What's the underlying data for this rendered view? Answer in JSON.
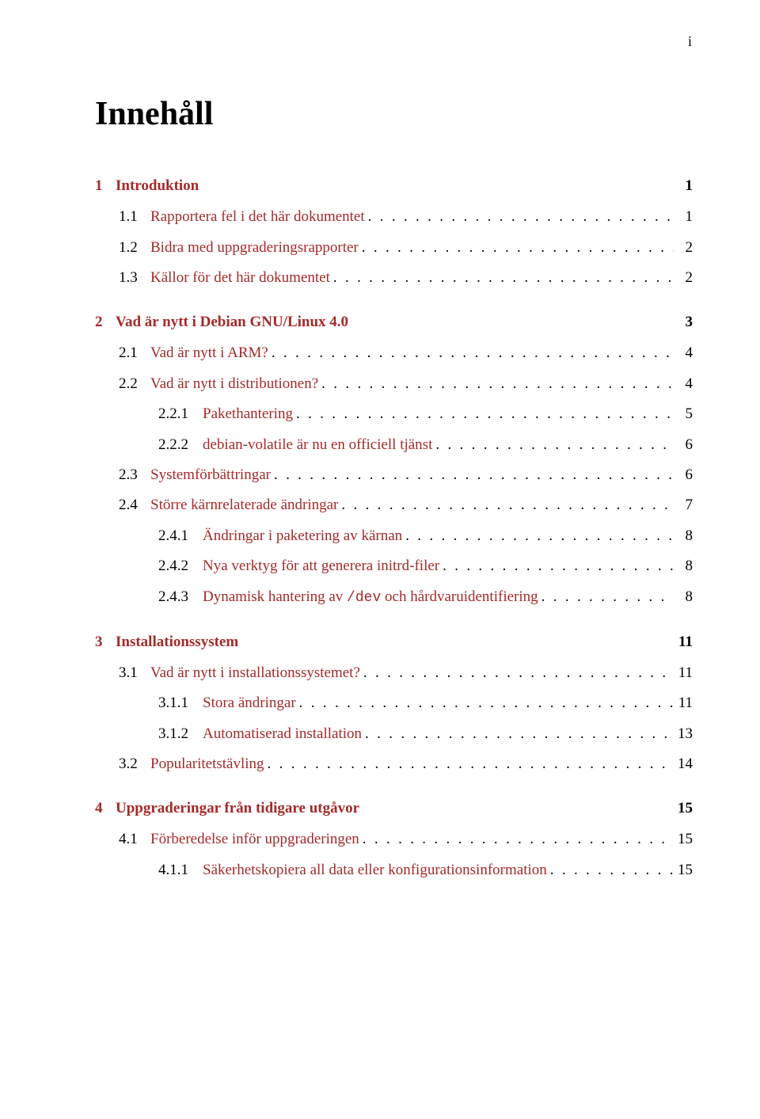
{
  "page_number_top": "i",
  "title": "Innehåll",
  "leader": ". . . . . . . . . . . . . . . . . . . . . . . . . . . . . . . . . . . . . . . . . . . . . . . . . . . . . . . . . . . .",
  "entries": [
    {
      "level": "chapter",
      "num": "1",
      "label": "Introduktion",
      "page": "1",
      "leader": false
    },
    {
      "level": "section",
      "num": "1.1",
      "label": "Rapportera fel i det här dokumentet",
      "page": "1",
      "leader": true
    },
    {
      "level": "section",
      "num": "1.2",
      "label": "Bidra med uppgraderingsrapporter",
      "page": "2",
      "leader": true
    },
    {
      "level": "section",
      "num": "1.3",
      "label": "Källor för det här dokumentet",
      "page": "2",
      "leader": true
    },
    {
      "level": "chapter",
      "num": "2",
      "label": "Vad är nytt i Debian GNU/Linux 4.0",
      "page": "3",
      "leader": false
    },
    {
      "level": "section",
      "num": "2.1",
      "label": "Vad är nytt i ARM?",
      "page": "4",
      "leader": true
    },
    {
      "level": "section",
      "num": "2.2",
      "label": "Vad är nytt i distributionen?",
      "page": "4",
      "leader": true
    },
    {
      "level": "subsection",
      "num": "2.2.1",
      "label": "Pakethantering",
      "page": "5",
      "leader": true
    },
    {
      "level": "subsection",
      "num": "2.2.2",
      "label": "debian-volatile är nu en officiell tjänst",
      "page": "6",
      "leader": true
    },
    {
      "level": "section",
      "num": "2.3",
      "label": "Systemförbättringar",
      "page": "6",
      "leader": true
    },
    {
      "level": "section",
      "num": "2.4",
      "label": "Större kärnrelaterade ändringar",
      "page": "7",
      "leader": true
    },
    {
      "level": "subsection",
      "num": "2.4.1",
      "label": "Ändringar i paketering av kärnan",
      "page": "8",
      "leader": true
    },
    {
      "level": "subsection",
      "num": "2.4.2",
      "label": "Nya verktyg för att generera initrd-filer",
      "page": "8",
      "leader": true
    },
    {
      "level": "subsection",
      "num": "2.4.3",
      "label_before": "Dynamisk hantering av ",
      "label_mono": "/dev",
      "label_after": " och hårdvaruidentifiering",
      "page": "8",
      "leader": true
    },
    {
      "level": "chapter",
      "num": "3",
      "label": "Installationssystem",
      "page": "11",
      "leader": false
    },
    {
      "level": "section",
      "num": "3.1",
      "label": "Vad är nytt i installationssystemet?",
      "page": "11",
      "leader": true
    },
    {
      "level": "subsection",
      "num": "3.1.1",
      "label": "Stora ändringar",
      "page": "11",
      "leader": true
    },
    {
      "level": "subsection",
      "num": "3.1.2",
      "label": "Automatiserad installation",
      "page": "13",
      "leader": true
    },
    {
      "level": "section",
      "num": "3.2",
      "label": "Popularitetstävling",
      "page": "14",
      "leader": true
    },
    {
      "level": "chapter",
      "num": "4",
      "label": "Uppgraderingar från tidigare utgåvor",
      "page": "15",
      "leader": false
    },
    {
      "level": "section",
      "num": "4.1",
      "label": "Förberedelse inför uppgraderingen",
      "page": "15",
      "leader": true
    },
    {
      "level": "subsection",
      "num": "4.1.1",
      "label": "Säkerhetskopiera all data eller konfigurationsinformation",
      "page": "15",
      "leader": true
    }
  ]
}
